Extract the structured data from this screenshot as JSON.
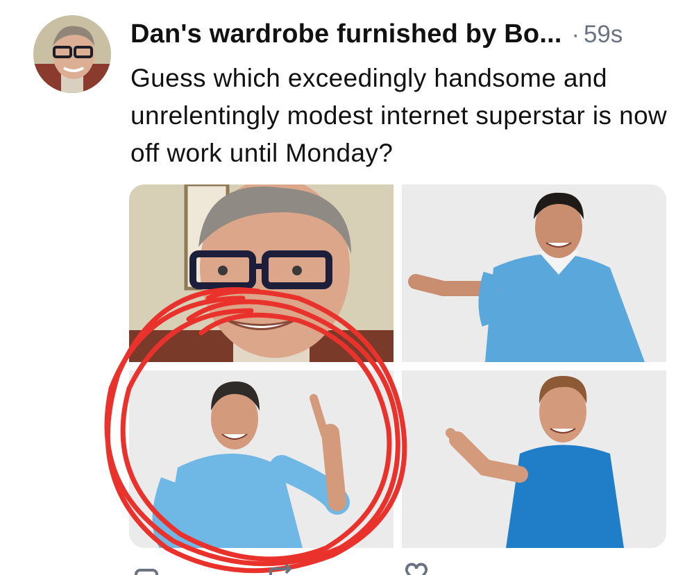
{
  "tweet": {
    "author_name": "Dan's wardrobe furnished by Bo...",
    "separator": "·",
    "timestamp": "59s",
    "text": "Guess which exceedingly handsome and unrelentingly modest internet superstar is now off work until Monday?"
  },
  "media": [
    {
      "name": "selfie-photo",
      "description_icon": "photo-icon"
    },
    {
      "name": "pointing-man-scrubs-photo",
      "description_icon": "photo-icon"
    },
    {
      "name": "pointing-up-man-shirt-photo",
      "description_icon": "photo-icon"
    },
    {
      "name": "pointing-man-tshirt-photo",
      "description_icon": "photo-icon"
    }
  ],
  "annotation": {
    "color": "#e8322b",
    "icon": "red-circle-annotation"
  },
  "actions": [
    {
      "icon": "reply-icon"
    },
    {
      "icon": "repost-icon"
    },
    {
      "icon": "like-icon"
    }
  ],
  "colors": {
    "text": "#111111",
    "muted": "#6b7280",
    "annotation": "#e8322b"
  }
}
